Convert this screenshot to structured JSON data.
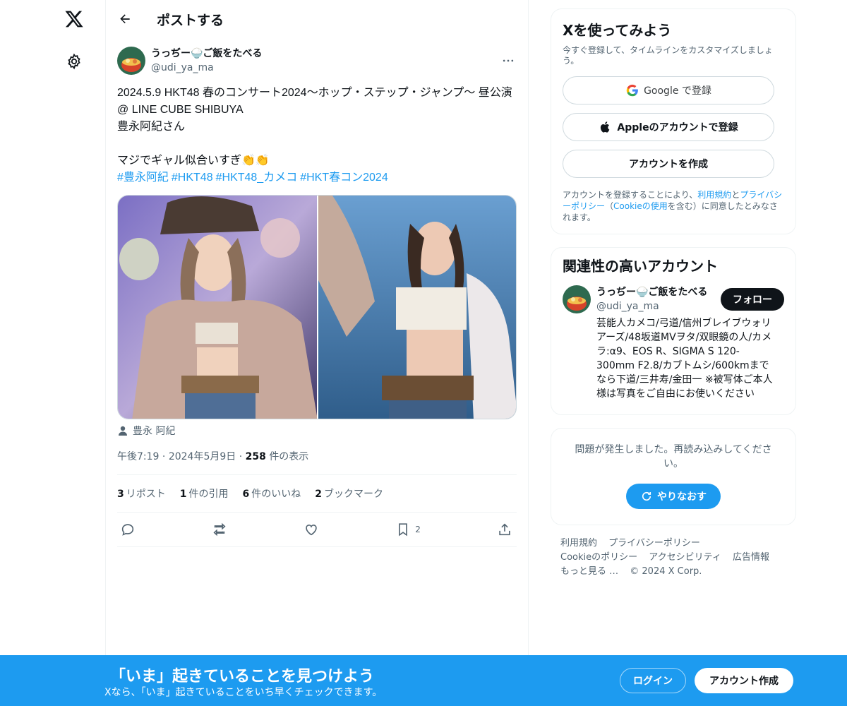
{
  "nav": {
    "logo_icon": "x-logo-icon",
    "settings_icon": "gear-icon"
  },
  "header": {
    "title": "ポストする"
  },
  "tweet": {
    "author_name": "うっぢー🍚ご飯をたべる",
    "author_handle": "@udi_ya_ma",
    "text": "2024.5.9 HKT48 春のコンサート2024〜ホップ・ステップ・ジャンプ〜 昼公演@ LINE CUBE SHIBUYA\n豊永阿紀さん\n\nマジでギャル似合いすぎ👏👏",
    "hashtags": [
      "#豊永阿紀",
      "#HKT48",
      "#HKT48_カメコ",
      "#HKT春コン2024"
    ],
    "tagged_person": "豊永 阿紀",
    "time": "午後7:19",
    "date": "2024年5月9日",
    "views_count": "258",
    "views_label": "件の表示",
    "stats": {
      "reposts_count": "3",
      "reposts_label": "リポスト",
      "quotes_count": "1",
      "quotes_label": "件の引用",
      "likes_count": "6",
      "likes_label": "件のいいね",
      "bookmarks_count": "2",
      "bookmarks_label": "ブックマーク"
    },
    "actions": {
      "bookmark_count": "2"
    }
  },
  "signup": {
    "title": "Xを使ってみよう",
    "subtitle": "今すぐ登録して、タイムラインをカスタマイズしましょう。",
    "google_label": "Google で登録",
    "apple_label": "Appleのアカウントで登録",
    "create_label": "アカウントを作成",
    "legal_prefix": "アカウントを登録することにより、",
    "legal_terms": "利用規約",
    "legal_and": "と",
    "legal_privacy": "プライバシーポリシー",
    "legal_paren_open": "（",
    "legal_cookie": "Cookieの使用",
    "legal_suffix": "を含む）に同意したとみなされます。"
  },
  "relevant": {
    "title": "関連性の高いアカウント",
    "user_name": "うっぢー🍚ご飯をたべる",
    "user_handle": "@udi_ya_ma",
    "bio": "芸能人カメコ/弓道/信州ブレイブウォリアーズ/48坂道MVヲタ/双眼鏡の人/カメラ:α9、EOS R、SIGMA S 120-300mm F2.8/カブトムシ/600kmまでなら下道/三井寿/金田一 ※被写体ご本人様は写真をご自由にお使いください",
    "follow_label": "フォロー"
  },
  "error": {
    "message": "問題が発生しました。再読み込みしてください。",
    "retry_label": "やりなおす"
  },
  "footer": {
    "links": [
      "利用規約",
      "プライバシーポリシー",
      "Cookieのポリシー",
      "アクセシビリティ",
      "広告情報",
      "もっと見る …",
      "© 2024 X Corp."
    ]
  },
  "banner": {
    "title": "「いま」起きていることを見つけよう",
    "subtitle": "Xなら、「いま」起きていることをいち早くチェックできます。",
    "login_label": "ログイン",
    "create_label": "アカウント作成"
  },
  "colors": {
    "accent": "#1d9bf0",
    "text": "#0f1419",
    "muted": "#536471"
  }
}
